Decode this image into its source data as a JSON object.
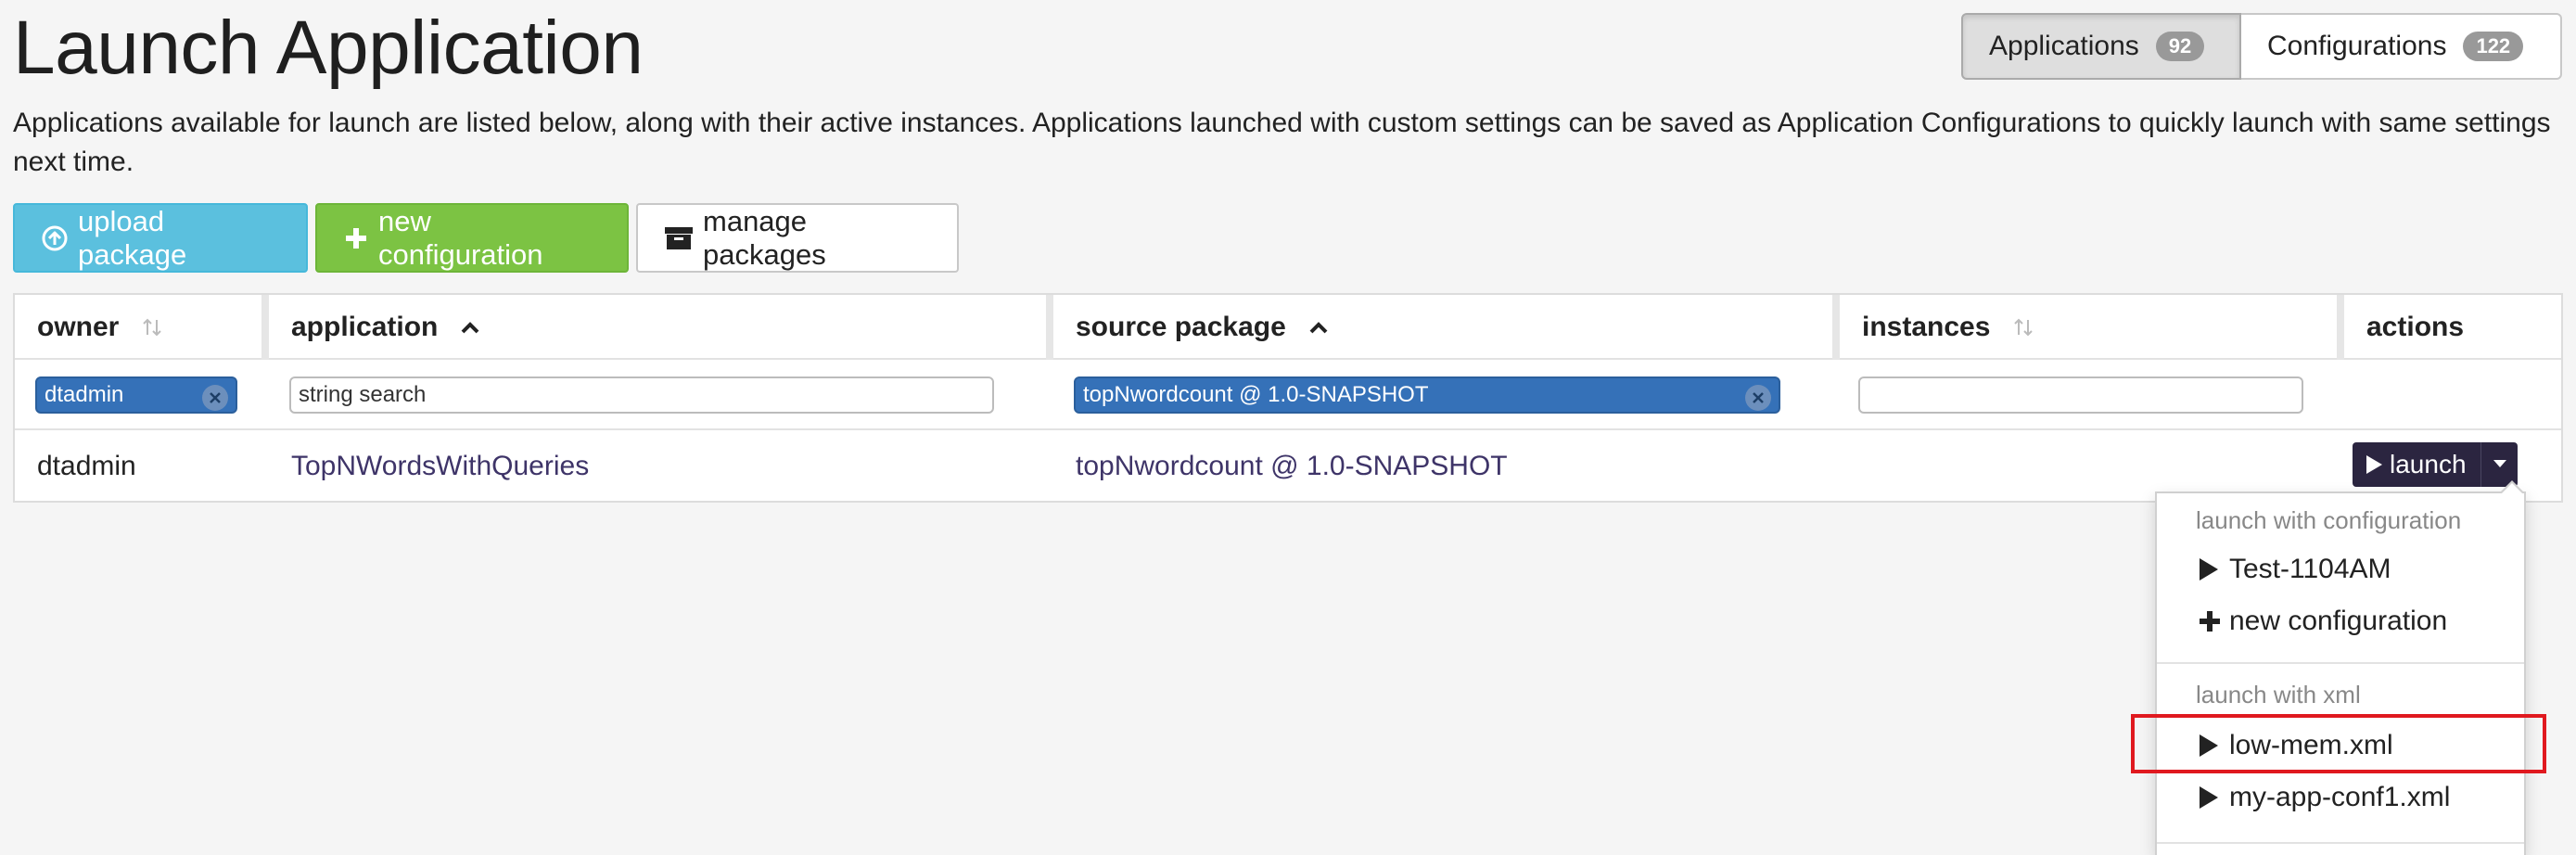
{
  "page": {
    "title": "Launch Application",
    "intro": "Applications available for launch are listed below, along with their active instances. Applications launched with custom settings can be saved as Application Configurations to quickly launch with same settings next time."
  },
  "view_toggle": {
    "applications_label": "Applications",
    "applications_count": "92",
    "configurations_label": "Configurations",
    "configurations_count": "122",
    "active": "Applications"
  },
  "toolbar": {
    "upload_label": "upload package",
    "new_config_label": "new configuration",
    "manage_label": "manage packages"
  },
  "table": {
    "headers": {
      "owner": "owner",
      "application": "application",
      "source_package": "source package",
      "instances": "instances",
      "actions": "actions"
    },
    "filters": {
      "owner": "dtadmin",
      "application_placeholder": "string search",
      "source_package": "topNwordcount @ 1.0-SNAPSHOT",
      "instances": ""
    },
    "rows": [
      {
        "owner": "dtadmin",
        "application": "TopNWordsWithQueries",
        "source_package": "topNwordcount @ 1.0-SNAPSHOT",
        "instances": "",
        "action_label": "launch"
      }
    ]
  },
  "launch_menu": {
    "config_header": "launch with configuration",
    "config_items": [
      "Test-1104AM",
      "new configuration"
    ],
    "xml_header": "launch with xml",
    "xml_items": [
      "low-mem.xml",
      "my-app-conf1.xml"
    ],
    "highlighted_item": "low-mem.xml"
  },
  "colors": {
    "upload": "#5bc0de",
    "new_configuration": "#7cc343",
    "filter_chip": "#3571b8",
    "launch_button": "#2b2540",
    "link_text": "#3e3468",
    "highlight": "#e0191f"
  },
  "icons": {
    "upload": "circle-arrow-up-icon",
    "new_configuration": "plus-icon",
    "manage": "archive-box-icon",
    "sort_neutral": "sort-arrows-icon",
    "sort_asc": "chevron-up-icon",
    "clear": "close-icon",
    "launch": "play-icon",
    "caret": "caret-down-icon"
  }
}
